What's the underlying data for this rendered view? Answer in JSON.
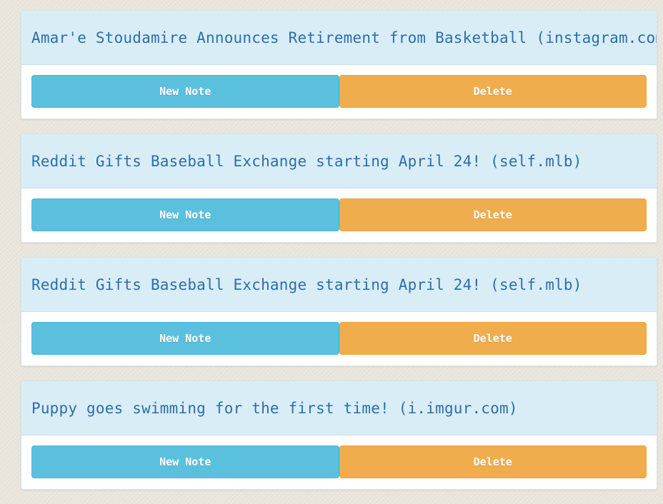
{
  "posts": [
    {
      "title": "Amar'e Stoudamire Announces Retirement from Basketball (instagram.com)",
      "new_note_label": "New Note",
      "delete_label": "Delete"
    },
    {
      "title": "Reddit Gifts Baseball Exchange starting April 24! (self.mlb)",
      "new_note_label": "New Note",
      "delete_label": "Delete"
    },
    {
      "title": "Reddit Gifts Baseball Exchange starting April 24! (self.mlb)",
      "new_note_label": "New Note",
      "delete_label": "Delete"
    },
    {
      "title": "Puppy goes swimming for the first time! (i.imgur.com)",
      "new_note_label": "New Note",
      "delete_label": "Delete"
    }
  ],
  "colors": {
    "heading_bg": "#d9edf7",
    "title_text": "#2c6fa8",
    "new_note_button": "#5bc0de",
    "delete_button": "#f0ad4e"
  }
}
